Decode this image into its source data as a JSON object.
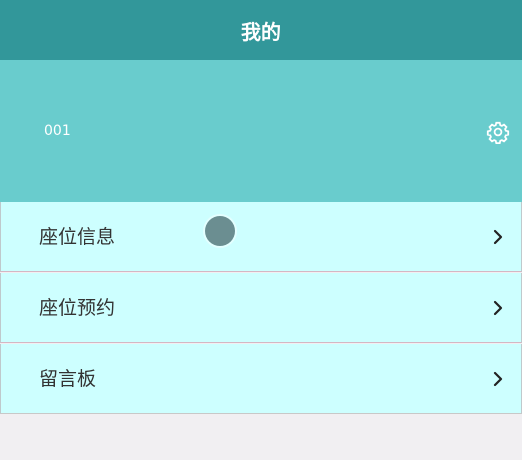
{
  "header": {
    "title": "我的"
  },
  "profile": {
    "user_id": "001",
    "settings_icon": "gear-icon"
  },
  "menu": {
    "items": [
      {
        "label": "座位信息",
        "icon": "chevron-right-icon"
      },
      {
        "label": "座位预约",
        "icon": "chevron-right-icon"
      },
      {
        "label": "留言板",
        "icon": "chevron-right-icon"
      }
    ]
  },
  "colors": {
    "header_bg": "#32979a",
    "profile_bg": "#69cccd",
    "menu_bg": "#cdffff",
    "page_bg": "#f1eff2"
  }
}
